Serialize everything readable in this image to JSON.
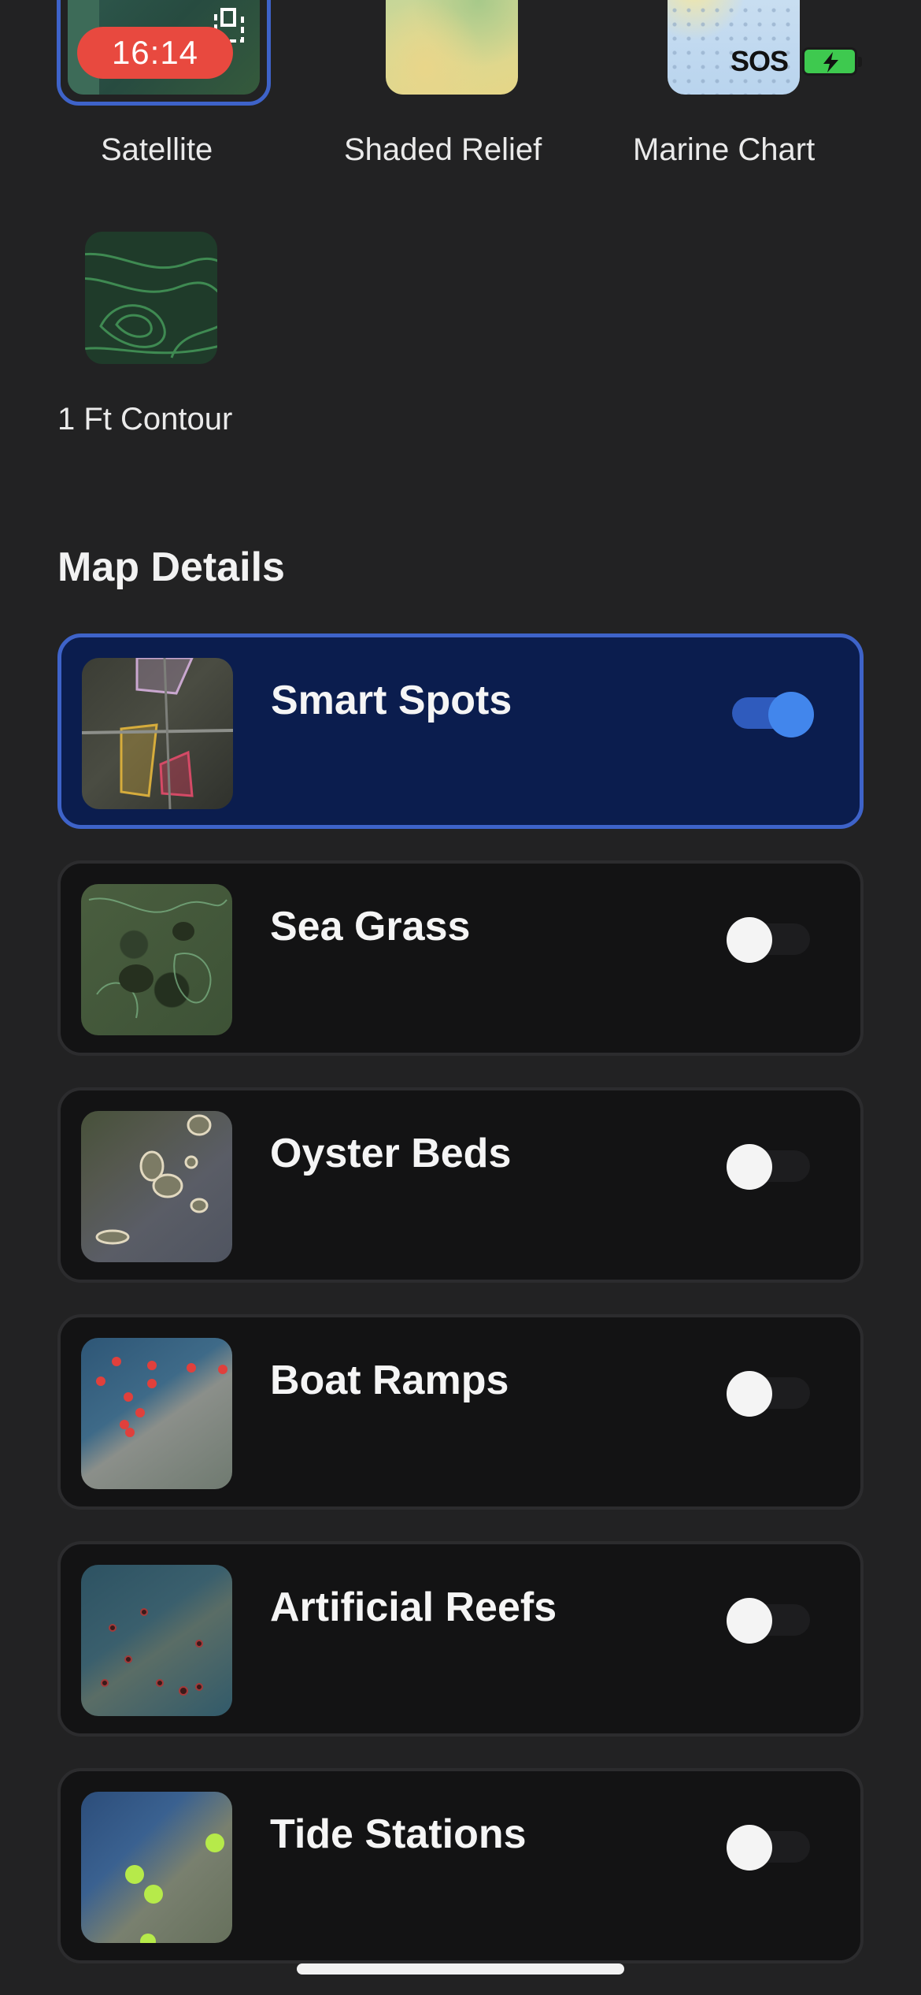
{
  "status_bar": {
    "time": "16:14",
    "sos": "SOS",
    "icons": [
      "screen-mirror-icon",
      "battery-charging-icon"
    ]
  },
  "map_types": [
    {
      "label": "Satellite",
      "selected": true
    },
    {
      "label": "Shaded Relief",
      "selected": false
    },
    {
      "label": "Marine Chart",
      "selected": false
    },
    {
      "label": "1 Ft Contour",
      "selected": false
    }
  ],
  "map_details": {
    "title": "Map Details",
    "items": [
      {
        "label": "Smart Spots",
        "enabled": true
      },
      {
        "label": "Sea Grass",
        "enabled": false
      },
      {
        "label": "Oyster Beds",
        "enabled": false
      },
      {
        "label": "Boat Ramps",
        "enabled": false
      },
      {
        "label": "Artificial Reefs",
        "enabled": false
      },
      {
        "label": "Tide Stations",
        "enabled": false
      }
    ]
  },
  "colors": {
    "background": "#222223",
    "accent": "#3e63c9",
    "active_card": "#0b1d4e",
    "toggle_on": "#4286ec",
    "time_pill": "#e8493f"
  }
}
